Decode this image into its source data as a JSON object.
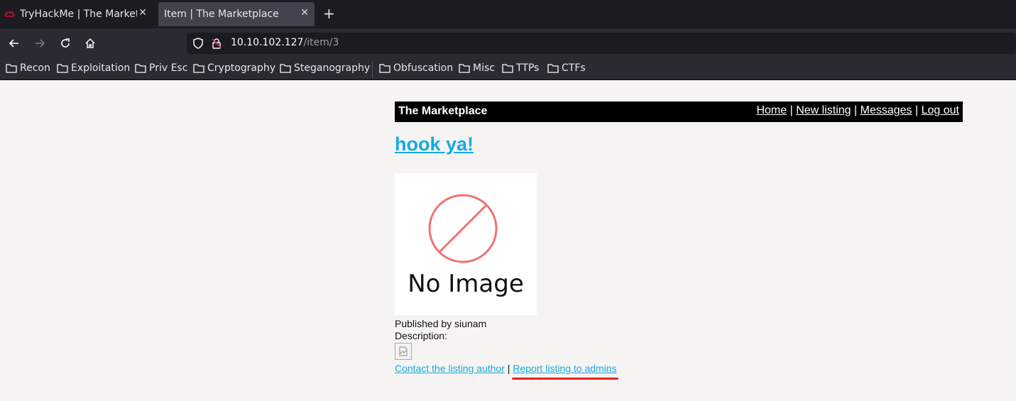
{
  "browser": {
    "tabs": [
      {
        "title": "TryHackMe | The Marketplace"
      },
      {
        "title": "Item | The Marketplace"
      }
    ],
    "url_host": "10.10.102.127",
    "url_path": "/item/3",
    "bookmarks": [
      "Recon",
      "Exploitation",
      "Priv Esc",
      "Cryptography",
      "Steganography",
      "Obfuscation",
      "Misc",
      "TTPs",
      "CTFs"
    ]
  },
  "site": {
    "title": "The Marketplace",
    "nav": {
      "home": "Home",
      "new_listing": "New listing",
      "messages": "Messages",
      "logout": "Log out",
      "separator": "|"
    }
  },
  "item": {
    "title": "hook ya!",
    "image_placeholder": "No Image",
    "published_by": "Published by siunam",
    "description_label": "Description:",
    "contact_link": "Contact the listing author",
    "separator": "|",
    "report_link": "Report listing to admins"
  },
  "colors": {
    "link": "#15a9e6",
    "highlight": "#e8251a",
    "header_bg": "#000000"
  }
}
